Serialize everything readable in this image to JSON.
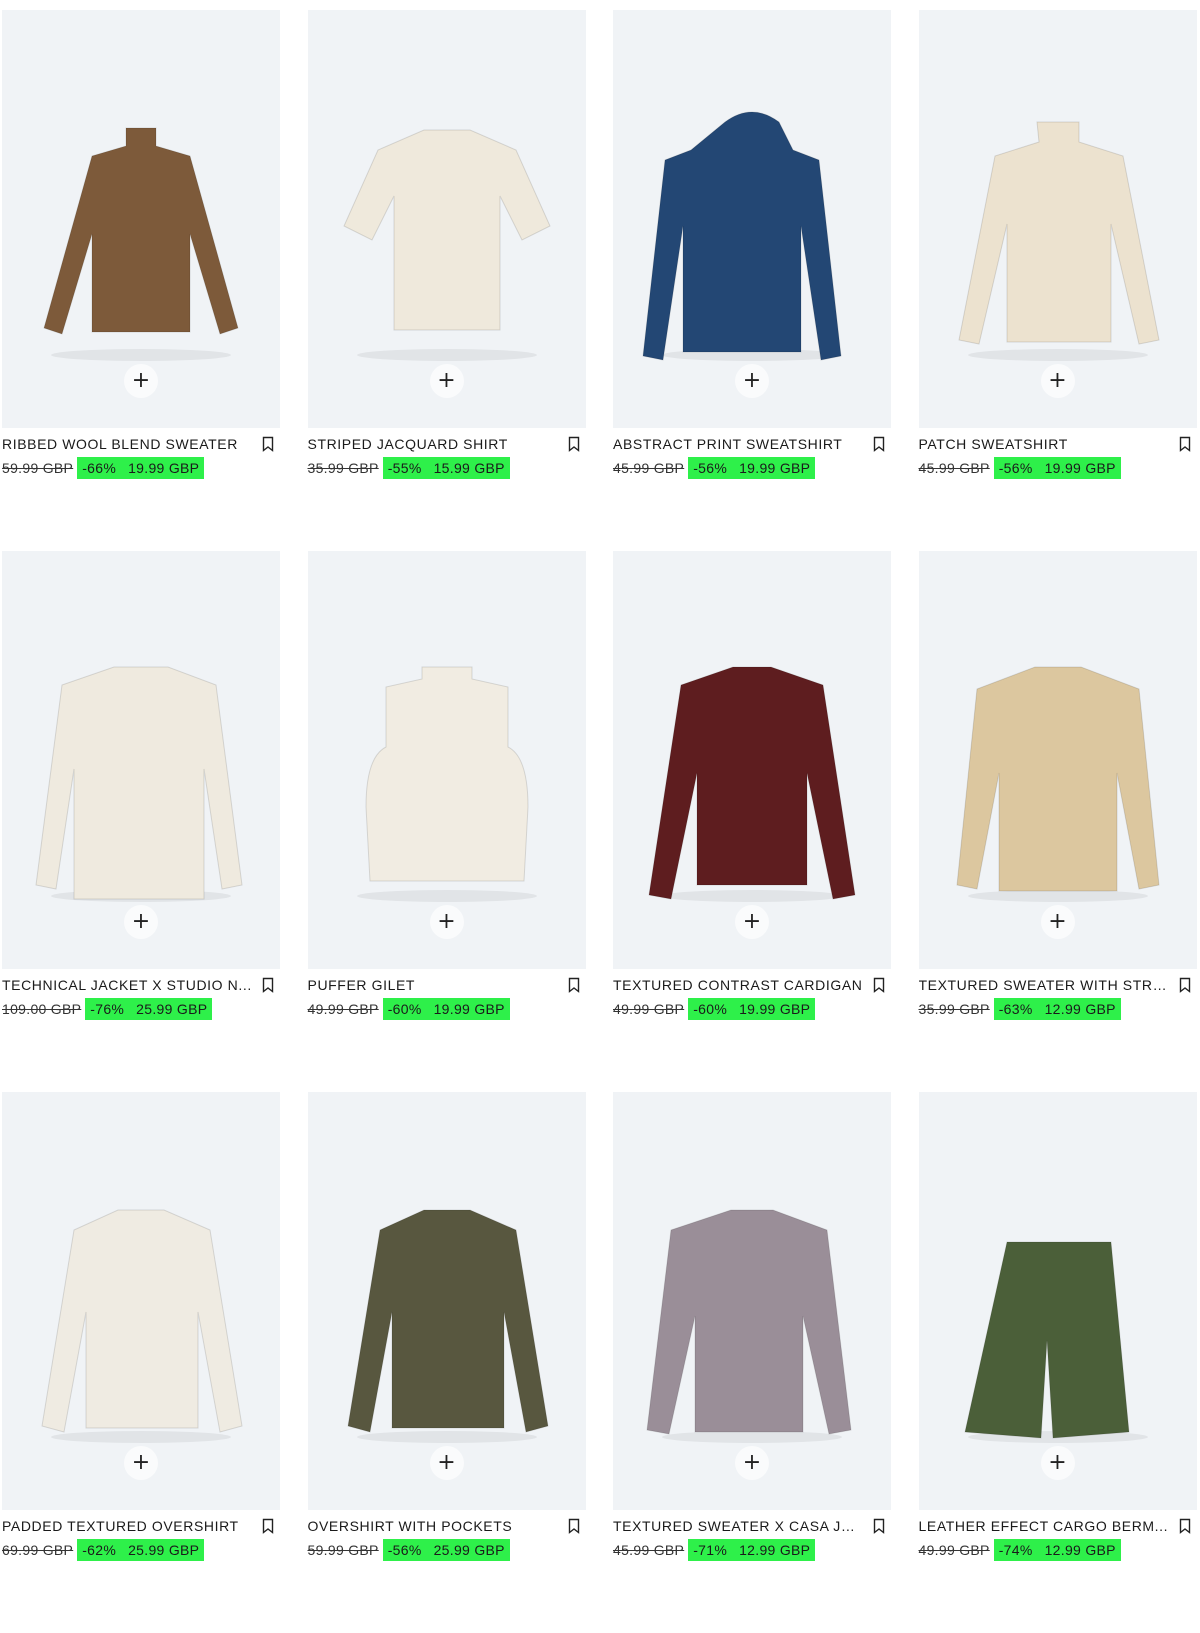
{
  "ui": {
    "add_symbol": "+"
  },
  "products": [
    {
      "name": "RIBBED WOOL BLEND SWEATER",
      "old_price": "59.99 GBP",
      "discount": "-66%",
      "price": "19.99 GBP",
      "color": "#7d5a3a",
      "kind": "turtleneck"
    },
    {
      "name": "STRIPED JACQUARD SHIRT",
      "old_price": "35.99 GBP",
      "discount": "-55%",
      "price": "15.99 GBP",
      "color": "#efe9dc",
      "kind": "shirt"
    },
    {
      "name": "ABSTRACT PRINT SWEATSHIRT",
      "old_price": "45.99 GBP",
      "discount": "-56%",
      "price": "19.99 GBP",
      "color": "#234774",
      "kind": "hoodie"
    },
    {
      "name": "PATCH SWEATSHIRT",
      "old_price": "45.99 GBP",
      "discount": "-56%",
      "price": "19.99 GBP",
      "color": "#ece2cf",
      "kind": "sweatshirt"
    },
    {
      "name": "TECHNICAL JACKET X STUDIO N...",
      "old_price": "109.00 GBP",
      "discount": "-76%",
      "price": "25.99 GBP",
      "color": "#efeadf",
      "kind": "jacket"
    },
    {
      "name": "PUFFER GILET",
      "old_price": "49.99 GBP",
      "discount": "-60%",
      "price": "19.99 GBP",
      "color": "#f1ece2",
      "kind": "gilet"
    },
    {
      "name": "TEXTURED CONTRAST CARDIGAN",
      "old_price": "49.99 GBP",
      "discount": "-60%",
      "price": "19.99 GBP",
      "color": "#5e1d1f",
      "kind": "cardigan"
    },
    {
      "name": "TEXTURED SWEATER WITH STRI...",
      "old_price": "35.99 GBP",
      "discount": "-63%",
      "price": "12.99 GBP",
      "color": "#dcc79f",
      "kind": "striped"
    },
    {
      "name": "PADDED TEXTURED OVERSHIRT",
      "old_price": "69.99 GBP",
      "discount": "-62%",
      "price": "25.99 GBP",
      "color": "#efebe2",
      "kind": "overshirt"
    },
    {
      "name": "OVERSHIRT WITH POCKETS",
      "old_price": "59.99 GBP",
      "discount": "-56%",
      "price": "25.99 GBP",
      "color": "#58573f",
      "kind": "overshirt"
    },
    {
      "name": "TEXTURED SWEATER X CASA JO...",
      "old_price": "45.99 GBP",
      "discount": "-71%",
      "price": "12.99 GBP",
      "color": "#9a8e98",
      "kind": "knit"
    },
    {
      "name": "LEATHER EFFECT CARGO BERM...",
      "old_price": "49.99 GBP",
      "discount": "-74%",
      "price": "12.99 GBP",
      "color": "#4b5f39",
      "kind": "shorts"
    }
  ]
}
